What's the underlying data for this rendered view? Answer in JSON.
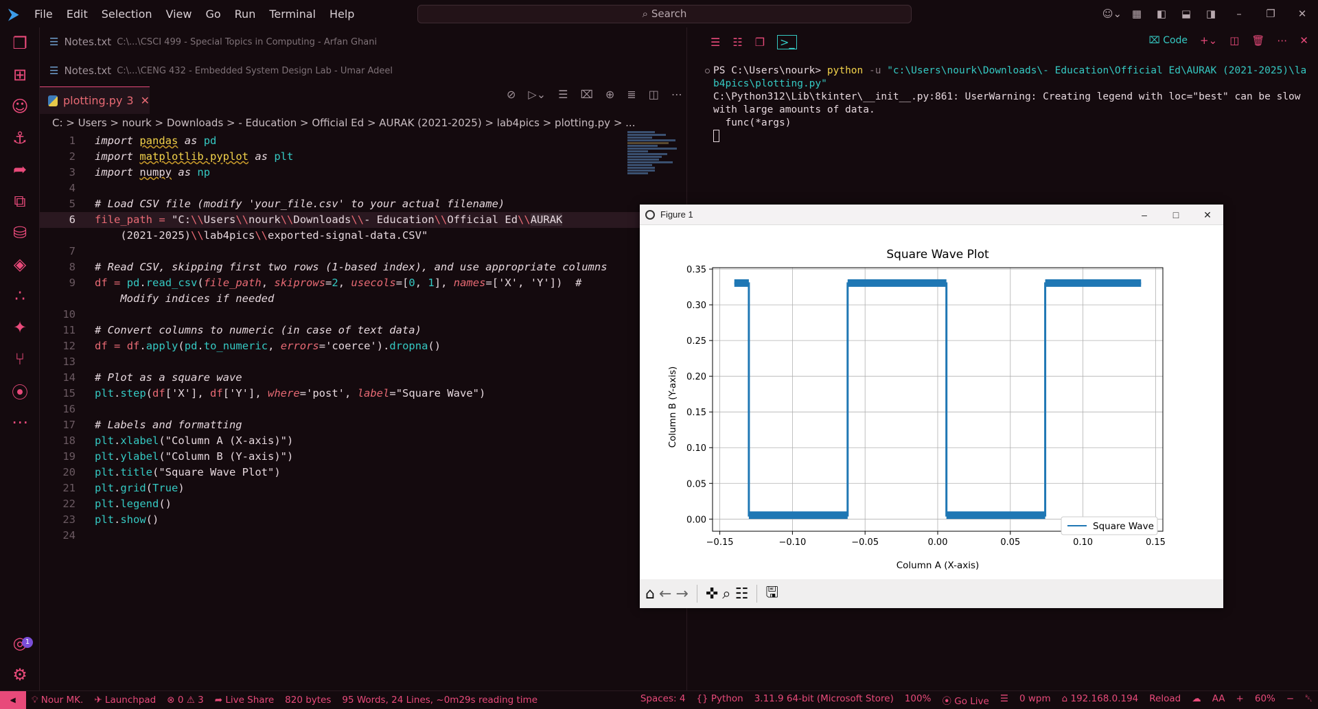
{
  "menu": [
    "File",
    "Edit",
    "Selection",
    "View",
    "Go",
    "Run",
    "Terminal",
    "Help"
  ],
  "search": {
    "label": "Search"
  },
  "tabs": [
    {
      "name": "Notes.txt",
      "path": "C:\\...\\CSCI 499 - Special Topics in Computing - Arfan Ghani"
    },
    {
      "name": "Notes.txt",
      "path": "C:\\...\\CENG 432 - Embedded System Design Lab - Umar Adeel"
    }
  ],
  "active_tab": {
    "name": "plotting.py",
    "problems": "3"
  },
  "breadcrumb": "C: > Users > nourk > Downloads > - Education > Official Ed > AURAK (2021-2025) > lab4pics > plotting.py > ...",
  "code_lines": [
    {
      "n": "1"
    },
    {
      "n": "2"
    },
    {
      "n": "3"
    },
    {
      "n": "4"
    },
    {
      "n": "5"
    },
    {
      "n": "6"
    },
    {
      "n": ""
    },
    {
      "n": "7"
    },
    {
      "n": "8"
    },
    {
      "n": "9"
    },
    {
      "n": ""
    },
    {
      "n": "10"
    },
    {
      "n": "11"
    },
    {
      "n": "12"
    },
    {
      "n": "13"
    },
    {
      "n": "14"
    },
    {
      "n": "15"
    },
    {
      "n": "16"
    },
    {
      "n": "17"
    },
    {
      "n": "18"
    },
    {
      "n": "19"
    },
    {
      "n": "20"
    },
    {
      "n": "21"
    },
    {
      "n": "22"
    },
    {
      "n": "23"
    },
    {
      "n": "24"
    }
  ],
  "terminal": {
    "prompt": "PS C:\\Users\\nourk> ",
    "cmd": "python",
    "flag": " -u ",
    "arg": "\"c:\\Users\\nourk\\Downloads\\- Education\\Official Ed\\AURAK (2021-2025)\\lab4pics\\plotting.py\"",
    "warning": "C:\\Python312\\Lib\\tkinter\\__init__.py:861: UserWarning: Creating legend with loc=\"best\" can be slow with large amounts of data.",
    "func": "  func(*args)"
  },
  "panel": {
    "code_label": "Code"
  },
  "figure": {
    "window_title": "Figure 1"
  },
  "chart_data": {
    "type": "line",
    "title": "Square Wave Plot",
    "xlabel": "Column A (X-axis)",
    "ylabel": "Column B (Y-axis)",
    "xlim": [
      -0.155,
      0.155
    ],
    "ylim": [
      -0.017,
      0.352
    ],
    "xticks": [
      "−0.15",
      "−0.10",
      "−0.05",
      "0.00",
      "0.05",
      "0.10",
      "0.15"
    ],
    "xtick_values": [
      -0.15,
      -0.1,
      -0.05,
      0.0,
      0.05,
      0.1,
      0.15
    ],
    "yticks": [
      "0.00",
      "0.05",
      "0.10",
      "0.15",
      "0.20",
      "0.25",
      "0.30",
      "0.35"
    ],
    "ytick_values": [
      0.0,
      0.05,
      0.1,
      0.15,
      0.2,
      0.25,
      0.3,
      0.35
    ],
    "grid": true,
    "legend": "lower right",
    "series": [
      {
        "name": "Square Wave",
        "color": "#1f77b4",
        "x": [
          -0.14,
          -0.13,
          -0.13,
          -0.062,
          -0.062,
          0.006,
          0.006,
          0.074,
          0.074,
          0.14
        ],
        "y": [
          0.33,
          0.33,
          0.005,
          0.005,
          0.33,
          0.33,
          0.005,
          0.005,
          0.33,
          0.33
        ]
      }
    ]
  },
  "status": {
    "user": "Nour MK.",
    "launchpad": "Launchpad",
    "errors": "0",
    "warnings": "3",
    "liveshare": "Live Share",
    "bytes": "820 bytes",
    "words": "95 Words, 24 Lines, ~0m29s reading time",
    "spaces": "Spaces: 4",
    "lang": "Python",
    "version": "3.11.9 64-bit (Microsoft Store)",
    "zoom": "100%",
    "golive": "Go Live",
    "wpm": "0 wpm",
    "ip": "192.168.0.194",
    "reload": "Reload",
    "font": "AA",
    "plus": "+",
    "pct": "60%",
    "minus": "−"
  },
  "notification_count": "1"
}
